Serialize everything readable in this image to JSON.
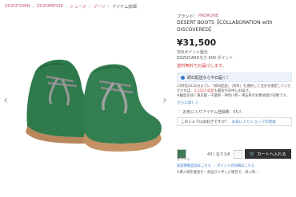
{
  "breadcrumb": {
    "items": [
      "ZOZOTOWN",
      "ZOZOMESSE",
      "シューズ",
      "ブーツ",
      "アイテム詳細"
    ]
  },
  "product": {
    "brand_label": "ブランド：",
    "brand_name": "PADRONE",
    "title": "DESERT BOOTS【COLLABORATION with DISCOVERED】",
    "price": "¥31,500",
    "points_line1": "300ポイント還元",
    "points_line2": "ZOZOCARDなら 600 ポイント",
    "shipping_free": "送料無料でお届けします。",
    "notice": "即日配送なら今日届く！",
    "desc_part1": "21時迄2232分までに「即日配送」（有料）を選択して注文を確定していただければ、",
    "desc_red": "3,253人収足",
    "desc_part2": "も最短今日中にお届け。",
    "desc_line3": "※離島を除く東京都・千葉県・神奈川県・埼玉県の対象地域が対象です。",
    "more_link": "さらに詳しく",
    "favorites": "お気に入りアイテム登録数：55人",
    "size_text": "このシルマはお好きですか？",
    "size_link": "お気に入りショップの登録",
    "color_name": "グリーン",
    "stock": "40 / 在り1点",
    "cart_label": "カートへ入れる",
    "footer_link1": "送迎期限追加はこちら ｜ ポイントの詳細はこちら",
    "footer_note": "※異入間を能別せ・商品が入手した場合で、再入荷..."
  },
  "colors": {
    "accent": "#c05a86",
    "boot_green": "#2f7a4c",
    "cart_button": "#2f2f2f",
    "price_red": "#d23a3a"
  },
  "icons": {
    "prev": "chevron-left-icon",
    "next": "chevron-right-icon",
    "heart": "heart-icon",
    "cart": "cart-icon"
  }
}
